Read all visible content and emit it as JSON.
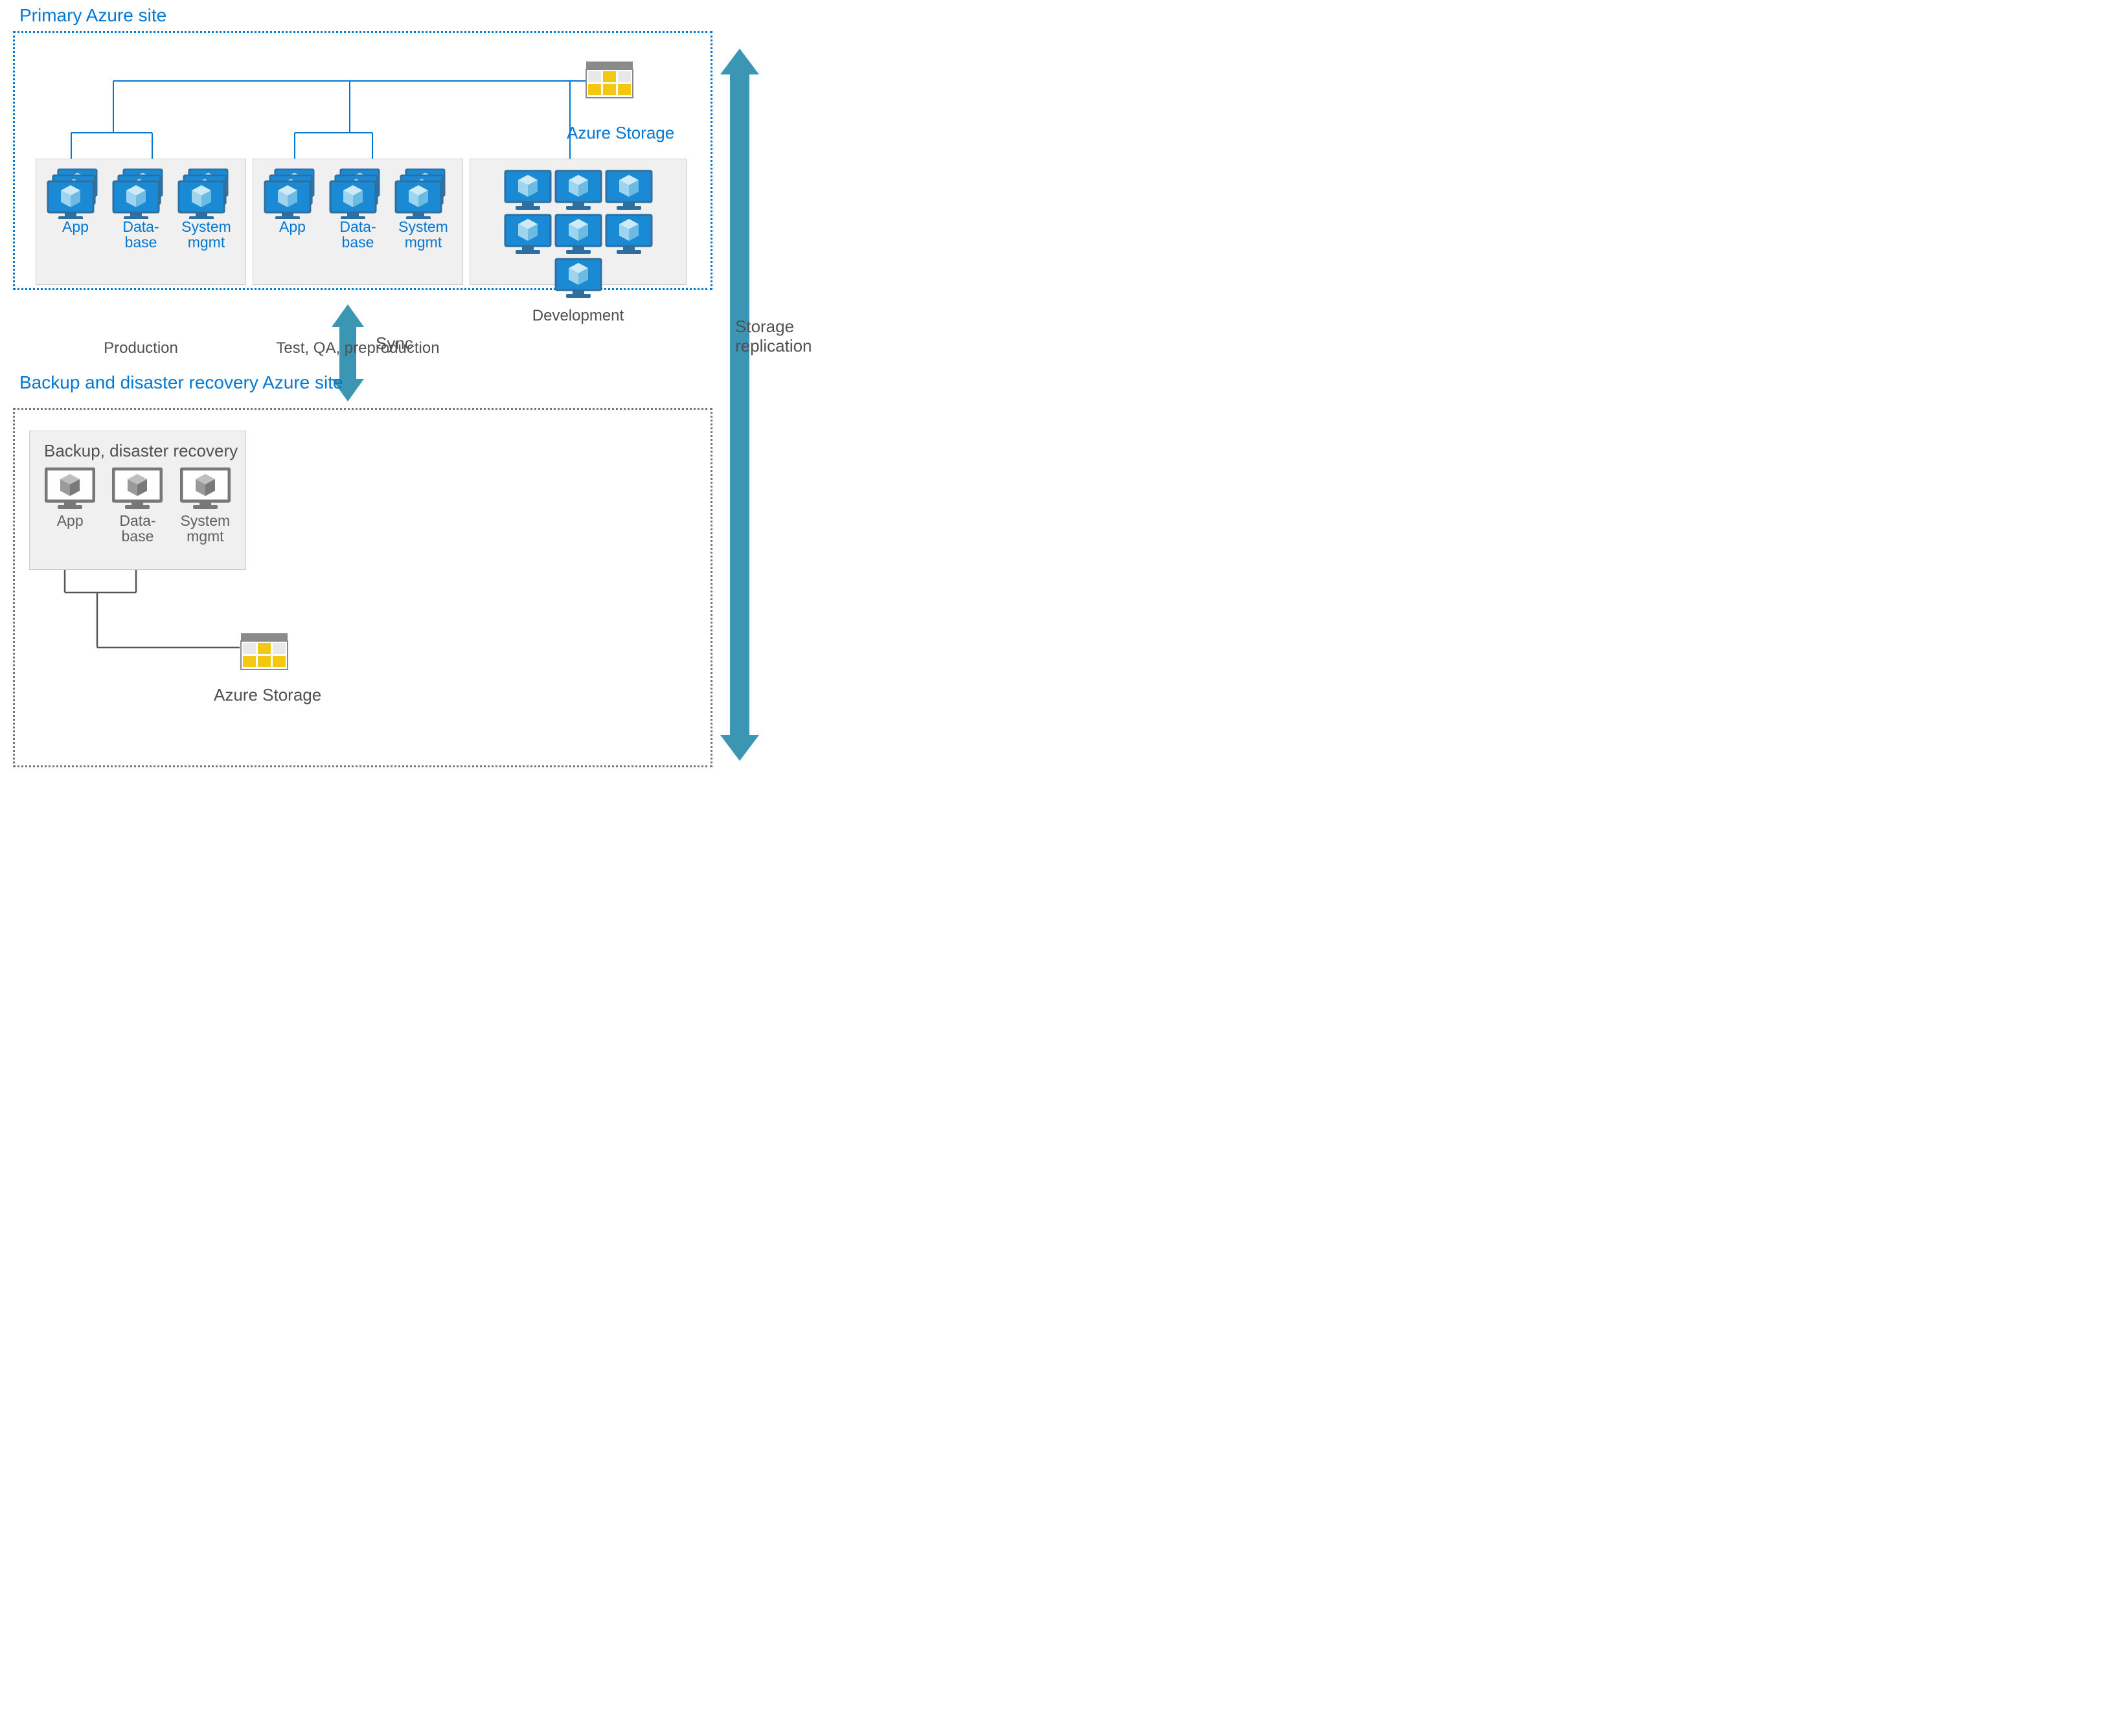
{
  "sites": {
    "primary": {
      "title": "Primary Azure site"
    },
    "backup": {
      "title": "Backup and disaster recovery Azure site"
    }
  },
  "environments": {
    "production": {
      "title": "Production",
      "labels": {
        "app": "App",
        "db": "Data-\nbase",
        "sys": "System\nmgmt"
      }
    },
    "test": {
      "title": "Test, QA, preproduction",
      "labels": {
        "app": "App",
        "db": "Data-\nbase",
        "sys": "System\nmgmt"
      }
    },
    "development": {
      "title": "Development"
    },
    "backup": {
      "title": "Backup, disaster recovery",
      "labels": {
        "app": "App",
        "db": "Data-\nbase",
        "sys": "System\nmgmt"
      }
    }
  },
  "storage": {
    "primary_label": "Azure Storage",
    "backup_label": "Azure Storage"
  },
  "arrows": {
    "sync": "Sync",
    "replication": "Storage\nreplication"
  },
  "colors": {
    "azure_blue": "#0078d4",
    "teal": "#3a96b3",
    "gray": "#777777",
    "light_blue": "#5bb0e8",
    "screen_blue": "#1a8ad4",
    "yellow": "#f2c811"
  }
}
